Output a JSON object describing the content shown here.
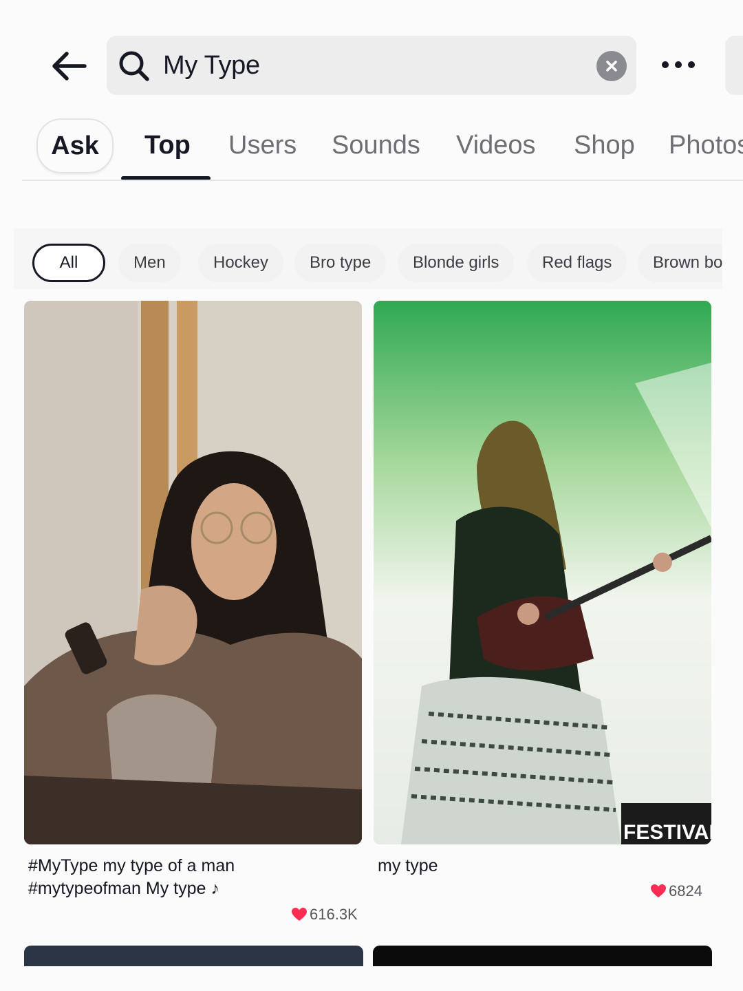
{
  "search": {
    "query": "My Type"
  },
  "tabs": [
    {
      "label": "Ask"
    },
    {
      "label": "Top"
    },
    {
      "label": "Users"
    },
    {
      "label": "Sounds"
    },
    {
      "label": "Videos"
    },
    {
      "label": "Shop"
    },
    {
      "label": "Photos"
    }
  ],
  "filters": [
    {
      "label": "All"
    },
    {
      "label": "Men"
    },
    {
      "label": "Hockey"
    },
    {
      "label": "Bro type"
    },
    {
      "label": "Blonde girls"
    },
    {
      "label": "Red flags"
    },
    {
      "label": "Brown boys"
    }
  ],
  "results": [
    {
      "caption_line1": "#MyType my type of a man",
      "caption_line2": "#mytypeofman My type ♪",
      "likes": "616.3K"
    },
    {
      "caption_line1": "my type",
      "likes": "6824",
      "watermark": "FESTIVALP"
    }
  ],
  "colors": {
    "accent": "#161823",
    "heart": "#fe2c55",
    "search_bg": "#ededee"
  },
  "icons": [
    "back-arrow-icon",
    "search-icon",
    "clear-icon",
    "more-icon",
    "heart-icon"
  ]
}
